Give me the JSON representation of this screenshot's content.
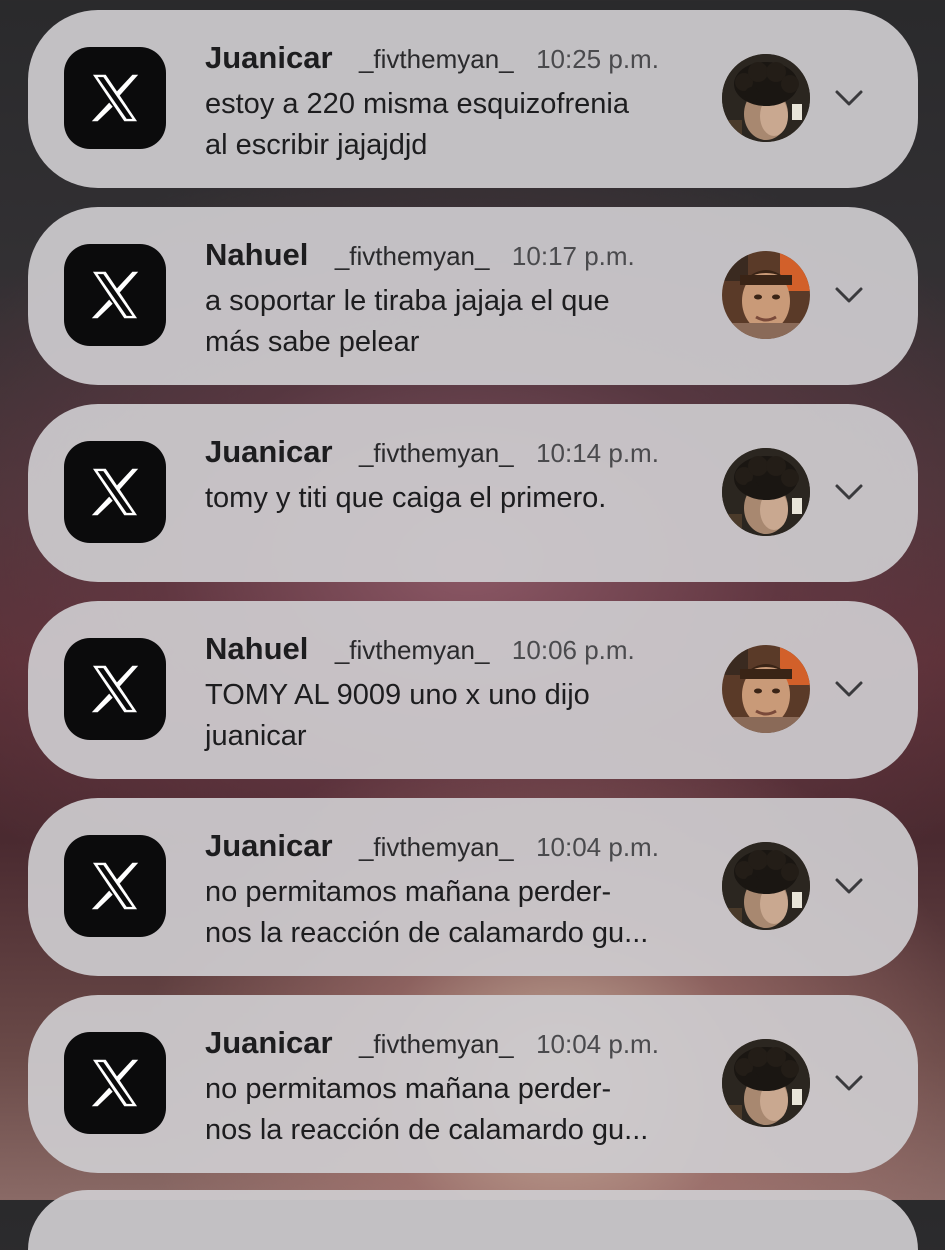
{
  "notifications": [
    {
      "sender": "Juanicar",
      "handle": "_fivthemyan_",
      "time": "10:25 p.m.",
      "message": "estoy a 220 misma esquizofrenia\nal escribir jajajdjd",
      "app_icon": "x-logo-icon",
      "avatar": "juanicar-avatar"
    },
    {
      "sender": "Nahuel",
      "handle": "_fivthemyan_",
      "time": "10:17 p.m.",
      "message": "a soportar le tiraba jajaja el que\nmás sabe pelear",
      "app_icon": "x-logo-icon",
      "avatar": "nahuel-avatar"
    },
    {
      "sender": "Juanicar",
      "handle": "_fivthemyan_",
      "time": "10:14 p.m.",
      "message": "tomy y titi que caiga el primero.",
      "app_icon": "x-logo-icon",
      "avatar": "juanicar-avatar"
    },
    {
      "sender": "Nahuel",
      "handle": "_fivthemyan_",
      "time": "10:06 p.m.",
      "message": "TOMY AL 9009 uno x uno dijo\njuanicar",
      "app_icon": "x-logo-icon",
      "avatar": "nahuel-avatar"
    },
    {
      "sender": "Juanicar",
      "handle": "_fivthemyan_",
      "time": "10:04 p.m.",
      "message": "no permitamos mañana perder-\nnos la reacción de calamardo gu...",
      "app_icon": "x-logo-icon",
      "avatar": "juanicar-avatar"
    },
    {
      "sender": "Juanicar",
      "handle": "_fivthemyan_",
      "time": "10:04 p.m.",
      "message": "no permitamos mañana perder-\nnos la reacción de calamardo gu...",
      "app_icon": "x-logo-icon",
      "avatar": "juanicar-avatar"
    }
  ],
  "colors": {
    "card_background": "#cecbcf",
    "app_icon_background": "#0b0b0c",
    "text_primary": "#1d1d1f",
    "text_secondary": "#4a4a4d"
  }
}
